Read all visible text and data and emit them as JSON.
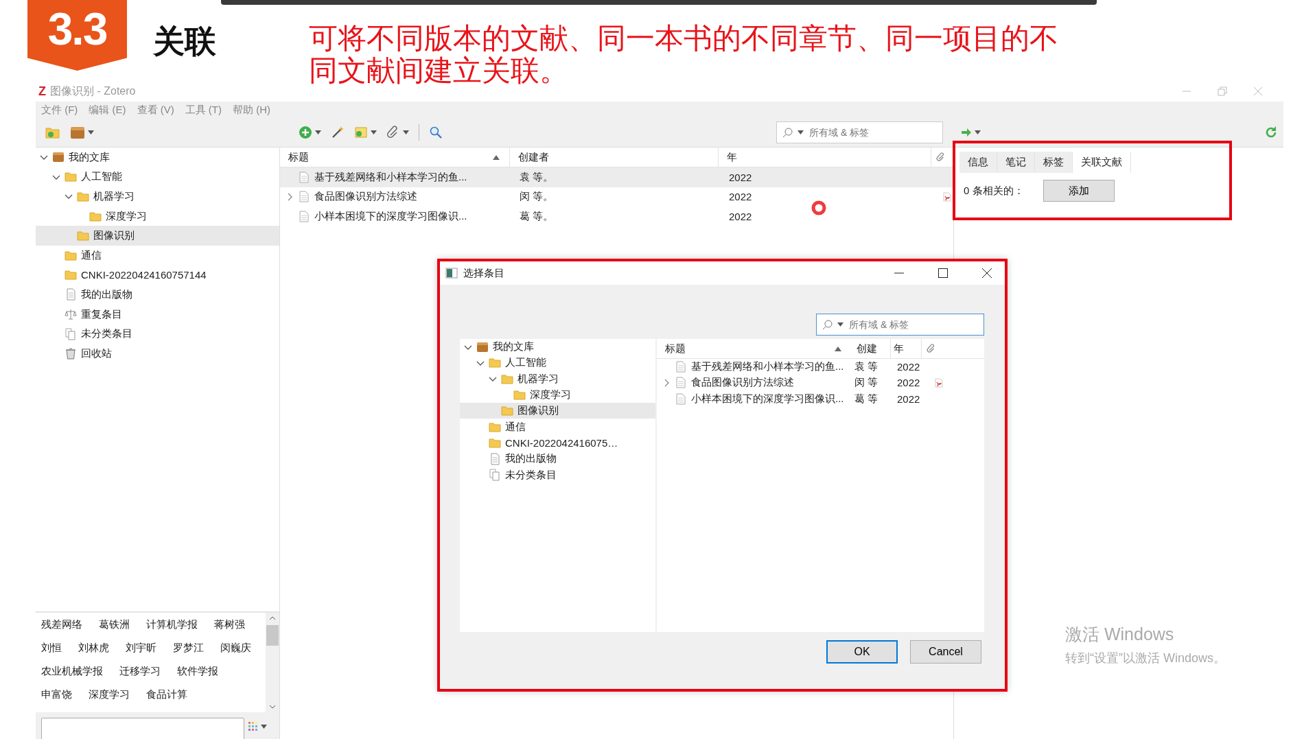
{
  "slide": {
    "badge": "3.3",
    "title": "关联",
    "caption": "可将不同版本的文献、同一本书的不同章节、同一项目的不同文献间建立关联。"
  },
  "window": {
    "logo": "Z",
    "title": "图像识别 - Zotero",
    "menus": [
      "文件 (F)",
      "编辑 (E)",
      "查看 (V)",
      "工具 (T)",
      "帮助 (H)"
    ],
    "search_placeholder": "所有域 & 标签"
  },
  "collections": [
    {
      "kind": "library",
      "label": "我的文库",
      "expanded": true,
      "selected": false,
      "children": [
        {
          "kind": "folder",
          "label": "人工智能",
          "expanded": true,
          "selected": false,
          "children": [
            {
              "kind": "folder",
              "label": "机器学习",
              "expanded": true,
              "selected": false,
              "children": [
                {
                  "kind": "folder",
                  "label": "深度学习",
                  "selected": false
                }
              ]
            },
            {
              "kind": "folder",
              "label": "图像识别",
              "selected": true
            }
          ]
        },
        {
          "kind": "folder",
          "label": "通信",
          "selected": false
        },
        {
          "kind": "folder",
          "label": "CNKI-20220424160757144",
          "selected": false
        },
        {
          "kind": "publications",
          "label": "我的出版物",
          "selected": false
        },
        {
          "kind": "duplicates",
          "label": "重复条目",
          "selected": false
        },
        {
          "kind": "unfiled",
          "label": "未分类条目",
          "selected": false
        },
        {
          "kind": "trash",
          "label": "回收站",
          "selected": false
        }
      ]
    }
  ],
  "tags": [
    "残差网络",
    "葛铁洲",
    "计算机学报",
    "蒋树强",
    "刘恒",
    "刘林虎",
    "刘宇昕",
    "罗梦江",
    "闵巍庆",
    "农业机械学报",
    "迁移学习",
    "软件学报",
    "申富饶",
    "深度学习",
    "食品计算"
  ],
  "items": {
    "columns": [
      "标题",
      "创建者",
      "年"
    ],
    "rows": [
      {
        "title": "基于残差网络和小样本学习的鱼...",
        "creator": "袁 等。",
        "year": "2022",
        "expandable": false,
        "pdf": false,
        "selected": true
      },
      {
        "title": "食品图像识别方法综述",
        "creator": "闵 等。",
        "year": "2022",
        "expandable": true,
        "pdf": true,
        "selected": false
      },
      {
        "title": "小样本困境下的深度学习图像识...",
        "creator": "葛 等。",
        "year": "2022",
        "expandable": false,
        "pdf": false,
        "selected": false
      }
    ]
  },
  "item_pane": {
    "tabs": [
      {
        "label": "信息",
        "selected": false
      },
      {
        "label": "笔记",
        "selected": false
      },
      {
        "label": "标签",
        "selected": false
      },
      {
        "label": "关联文献",
        "selected": true
      }
    ],
    "related_count": "0 条相关的：",
    "add_button": "添加"
  },
  "dialog": {
    "title": "选择条目",
    "search_placeholder": "所有域 & 标签",
    "collections": [
      {
        "kind": "library",
        "label": "我的文库",
        "expanded": true,
        "selected": false,
        "children": [
          {
            "kind": "folder",
            "label": "人工智能",
            "expanded": true,
            "selected": false,
            "children": [
              {
                "kind": "folder",
                "label": "机器学习",
                "expanded": true,
                "selected": false,
                "children": [
                  {
                    "kind": "folder",
                    "label": "深度学习",
                    "selected": false
                  }
                ]
              },
              {
                "kind": "folder",
                "label": "图像识别",
                "selected": true
              }
            ]
          },
          {
            "kind": "folder",
            "label": "通信",
            "selected": false
          },
          {
            "kind": "folder",
            "label": "CNKI-2022042416075…",
            "selected": false
          },
          {
            "kind": "publications",
            "label": "我的出版物",
            "selected": false
          },
          {
            "kind": "unfiled",
            "label": "未分类条目",
            "selected": false
          }
        ]
      }
    ],
    "columns": [
      "标题",
      "创建",
      "年"
    ],
    "rows": [
      {
        "title": "基于残差网络和小样本学习的鱼...",
        "creator": "袁 等",
        "year": "2022",
        "expandable": false,
        "pdf": false
      },
      {
        "title": "食品图像识别方法综述",
        "creator": "闵 等",
        "year": "2022",
        "expandable": true,
        "pdf": true
      },
      {
        "title": "小样本困境下的深度学习图像识...",
        "creator": "葛 等",
        "year": "2022",
        "expandable": false,
        "pdf": false
      }
    ],
    "buttons": [
      {
        "label": "OK",
        "default": true
      },
      {
        "label": "Cancel",
        "default": false
      }
    ]
  },
  "activation": {
    "title": "激活 Windows",
    "subtitle": "转到“设置”以激活 Windows。"
  }
}
